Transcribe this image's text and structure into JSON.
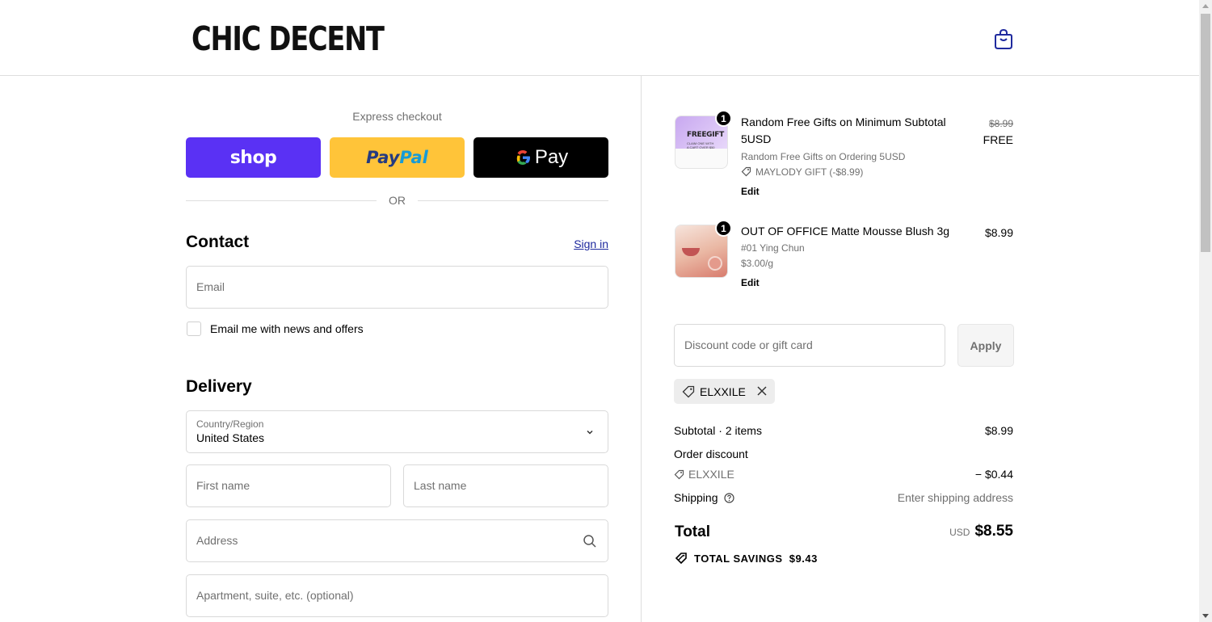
{
  "header": {
    "logo": "CHIC DECENT",
    "bag_icon": "shopping-bag-icon"
  },
  "express": {
    "title": "Express checkout",
    "shop_label": "shop",
    "paypal_label_1": "Pay",
    "paypal_label_2": "Pal",
    "gpay_g": "G",
    "gpay_label": "Pay",
    "or_text": "OR"
  },
  "contact": {
    "title": "Contact",
    "sign_in": "Sign in",
    "email_placeholder": "Email",
    "newsletter_label": "Email me with news and offers"
  },
  "delivery": {
    "title": "Delivery",
    "country_label": "Country/Region",
    "country_value": "United States",
    "first_name_placeholder": "First name",
    "last_name_placeholder": "Last name",
    "address_placeholder": "Address",
    "apartment_placeholder": "Apartment, suite, etc. (optional)"
  },
  "cart": {
    "items": [
      {
        "qty": "1",
        "title": "Random Free Gifts on Minimum Subtotal 5USD",
        "subtitle": "Random Free Gifts on Ordering 5USD",
        "discount": "MAYLODY GIFT (-$8.99)",
        "edit": "Edit",
        "original_price": "$8.99",
        "price": "FREE",
        "thumb_text_1": "FREEGIFT",
        "thumb_text_2": "CLAIM ONE WITH A CART OVER $50"
      },
      {
        "qty": "1",
        "title": "OUT OF OFFICE Matte Mousse Blush 3g",
        "variant": "#01 Ying Chun",
        "unit_price": "$3.00/g",
        "edit": "Edit",
        "price": "$8.99"
      }
    ],
    "discount_placeholder": "Discount code or gift card",
    "apply_label": "Apply",
    "applied_code": "ELXXILE"
  },
  "summary": {
    "subtotal_label": "Subtotal · 2 items",
    "subtotal_value": "$8.99",
    "order_discount_label": "Order discount",
    "discount_code": "ELXXILE",
    "discount_value": "− $0.44",
    "shipping_label": "Shipping",
    "shipping_value": "Enter shipping address",
    "total_label": "Total",
    "currency": "USD",
    "total_value": "$8.55",
    "savings_label": "TOTAL SAVINGS",
    "savings_value": "$9.43"
  },
  "colors": {
    "shop": "#5a31f4",
    "paypal": "#ffc439",
    "gpay": "#000000",
    "link": "#1f2a9e"
  }
}
